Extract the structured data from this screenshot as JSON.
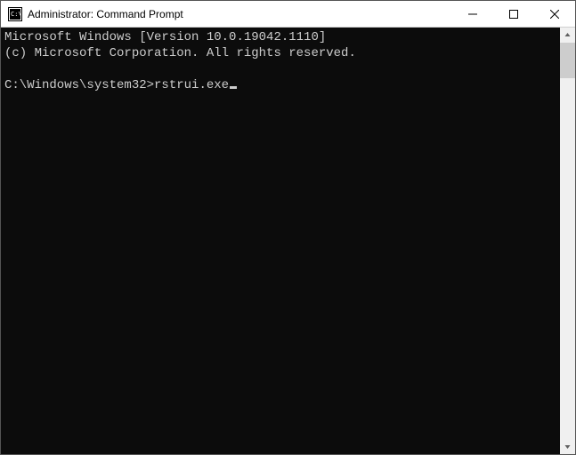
{
  "window": {
    "title": "Administrator: Command Prompt"
  },
  "terminal": {
    "line1": "Microsoft Windows [Version 10.0.19042.1110]",
    "line2": "(c) Microsoft Corporation. All rights reserved.",
    "blank": "",
    "prompt": "C:\\Windows\\system32>",
    "command": "rstrui.exe"
  }
}
